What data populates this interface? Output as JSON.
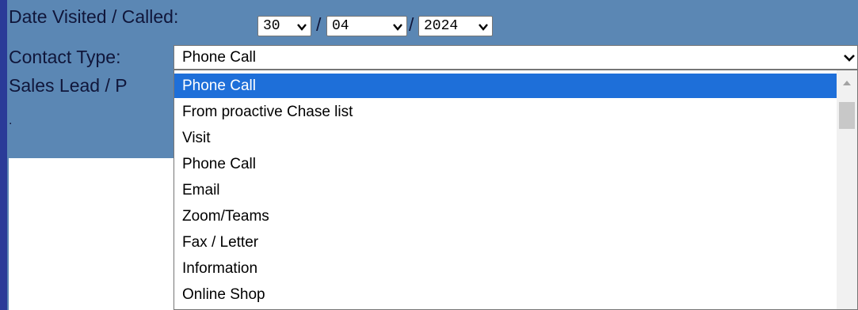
{
  "form": {
    "date_label": "Date Visited / Called:",
    "date": {
      "day": "30",
      "month": "04",
      "year": "2024",
      "separator": "/"
    },
    "contact_label": "Contact Type:",
    "contact_value": "Phone Call",
    "sales_label": "Sales Lead / P",
    "dot": "."
  },
  "dropdown": {
    "options": [
      {
        "label": "Phone Call",
        "selected": true
      },
      {
        "label": "From proactive Chase list",
        "selected": false
      },
      {
        "label": "Visit",
        "selected": false
      },
      {
        "label": "Phone Call",
        "selected": false
      },
      {
        "label": "Email",
        "selected": false
      },
      {
        "label": "Zoom/Teams",
        "selected": false
      },
      {
        "label": "Fax / Letter",
        "selected": false
      },
      {
        "label": "Information",
        "selected": false
      },
      {
        "label": "Online Shop",
        "selected": false
      }
    ]
  },
  "colors": {
    "panel": "#5b87b4",
    "edge": "#2a3b98",
    "highlight": "#1e6fd9"
  },
  "icons": {
    "select_arrow": "chevron-down-icon",
    "scroll_up": "scroll-up-arrow-icon"
  }
}
